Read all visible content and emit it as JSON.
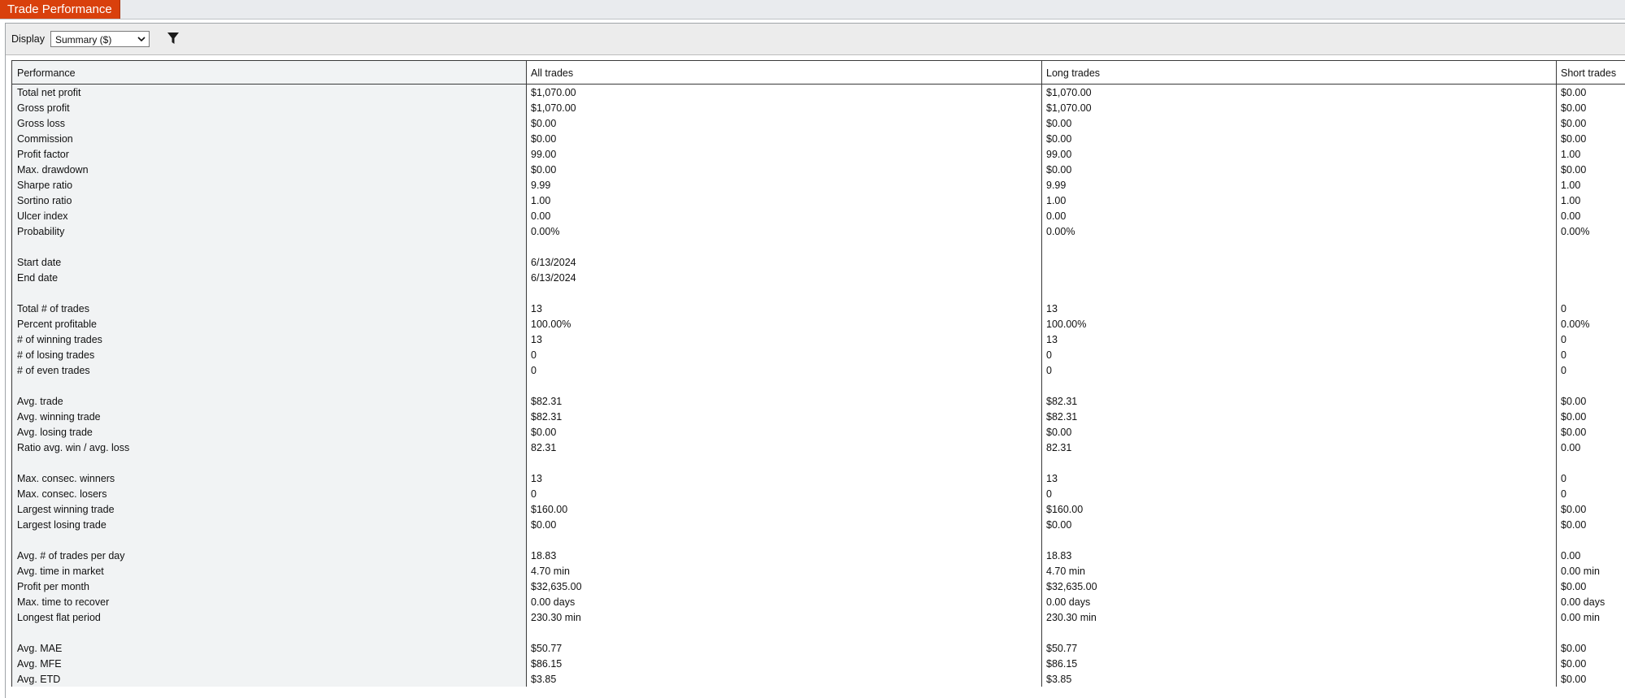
{
  "window": {
    "tab_title": "Trade Performance"
  },
  "toolbar": {
    "display_label": "Display",
    "display_value": "Summary ($)",
    "filter_icon": "filter-funnel-icon"
  },
  "table": {
    "headers": [
      "Performance",
      "All trades",
      "Long trades",
      "Short trades"
    ],
    "rows": [
      [
        "Total net profit",
        "$1,070.00",
        "$1,070.00",
        "$0.00"
      ],
      [
        "Gross profit",
        "$1,070.00",
        "$1,070.00",
        "$0.00"
      ],
      [
        "Gross loss",
        "$0.00",
        "$0.00",
        "$0.00"
      ],
      [
        "Commission",
        "$0.00",
        "$0.00",
        "$0.00"
      ],
      [
        "Profit factor",
        "99.00",
        "99.00",
        "1.00"
      ],
      [
        "Max. drawdown",
        "$0.00",
        "$0.00",
        "$0.00"
      ],
      [
        "Sharpe ratio",
        "9.99",
        "9.99",
        "1.00"
      ],
      [
        "Sortino ratio",
        "1.00",
        "1.00",
        "1.00"
      ],
      [
        "Ulcer index",
        "0.00",
        "0.00",
        "0.00"
      ],
      [
        "Probability",
        "0.00%",
        "0.00%",
        "0.00%"
      ],
      [
        "",
        "",
        "",
        ""
      ],
      [
        "Start date",
        "6/13/2024",
        "",
        ""
      ],
      [
        "End date",
        "6/13/2024",
        "",
        ""
      ],
      [
        "",
        "",
        "",
        ""
      ],
      [
        "Total # of trades",
        "13",
        "13",
        "0"
      ],
      [
        "Percent profitable",
        "100.00%",
        "100.00%",
        "0.00%"
      ],
      [
        "# of winning trades",
        "13",
        "13",
        "0"
      ],
      [
        "# of losing trades",
        "0",
        "0",
        "0"
      ],
      [
        "# of even trades",
        "0",
        "0",
        "0"
      ],
      [
        "",
        "",
        "",
        ""
      ],
      [
        "Avg. trade",
        "$82.31",
        "$82.31",
        "$0.00"
      ],
      [
        "Avg. winning trade",
        "$82.31",
        "$82.31",
        "$0.00"
      ],
      [
        "Avg. losing trade",
        "$0.00",
        "$0.00",
        "$0.00"
      ],
      [
        "Ratio avg. win / avg. loss",
        "82.31",
        "82.31",
        "0.00"
      ],
      [
        "",
        "",
        "",
        ""
      ],
      [
        "Max. consec. winners",
        "13",
        "13",
        "0"
      ],
      [
        "Max. consec. losers",
        "0",
        "0",
        "0"
      ],
      [
        "Largest winning trade",
        "$160.00",
        "$160.00",
        "$0.00"
      ],
      [
        "Largest losing trade",
        "$0.00",
        "$0.00",
        "$0.00"
      ],
      [
        "",
        "",
        "",
        ""
      ],
      [
        "Avg. # of trades per day",
        "18.83",
        "18.83",
        "0.00"
      ],
      [
        "Avg. time in market",
        "4.70 min",
        "4.70 min",
        "0.00 min"
      ],
      [
        "Profit per month",
        "$32,635.00",
        "$32,635.00",
        "$0.00"
      ],
      [
        "Max. time to recover",
        "0.00 days",
        "0.00 days",
        "0.00 days"
      ],
      [
        "Longest flat period",
        "230.30 min",
        "230.30 min",
        "0.00 min"
      ],
      [
        "",
        "",
        "",
        ""
      ],
      [
        "Avg. MAE",
        "$50.77",
        "$50.77",
        "$0.00"
      ],
      [
        "Avg. MFE",
        "$86.15",
        "$86.15",
        "$0.00"
      ],
      [
        "Avg. ETD",
        "$3.85",
        "$3.85",
        "$0.00"
      ]
    ]
  },
  "colors": {
    "tab_accent": "#d9400c",
    "label_column_bg": "#f1f3f4",
    "toolbar_bg": "#ececec"
  }
}
